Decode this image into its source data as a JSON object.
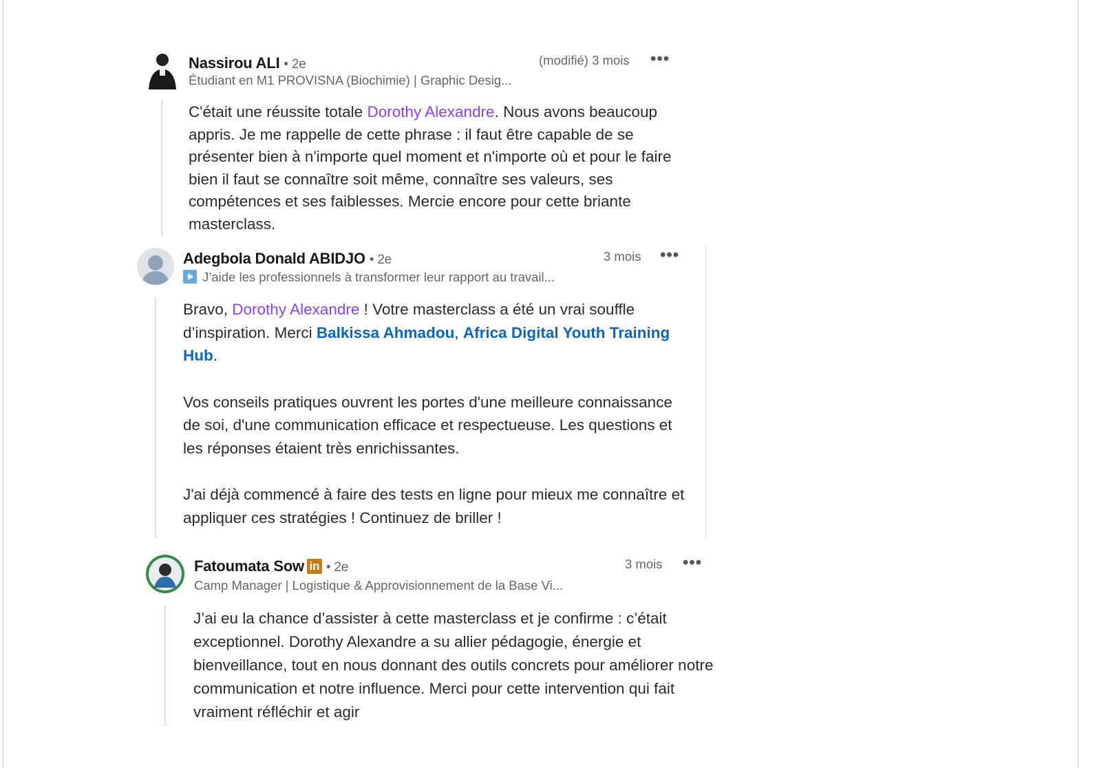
{
  "comments": [
    {
      "author": "Nassirou ALI",
      "degree": "• 2e",
      "headline": "Étudiant en M1 PROVISNA (Biochimie) | Graphic Desig...",
      "time": "(modifié) 3 mois",
      "more_icon": "ellipsis-icon",
      "text_before": "C'était une réussite totale ",
      "mention": "Dorothy Alexandre",
      "text_after": ". Nous avons beaucoup appris. Je me rappelle de cette phrase : il faut être capable de se présenter bien à n'importe quel moment et n'importe où et pour le faire bien il faut se connaître soit même, connaître ses valeurs, ses compétences et ses faiblesses. Mercie encore pour cette briante masterclass."
    },
    {
      "author": "Adegbola Donald ABIDJO",
      "degree": "• 2e",
      "headline": "J’aide les professionnels à transformer leur rapport au travail...",
      "time": "3 mois",
      "more_icon": "ellipsis-icon",
      "p1_before": "Bravo, ",
      "p1_mention": "Dorothy Alexandre",
      "p1_middle": " ! Votre masterclass a été un vrai souffle d’inspiration. Merci ",
      "p1_link1": "Balkissa Ahmadou",
      "p1_comma": ", ",
      "p1_link2": "Africa Digital Youth Training Hub",
      "p1_end": ".",
      "p2": "Vos conseils pratiques ouvrent les portes d'une meilleure connaissance de soi, d'une communication efficace et respectueuse. Les questions et les réponses étaient très enrichissantes.",
      "p3": "J'ai déjà commencé à faire des tests en ligne pour mieux me connaître et appliquer ces stratégies ! Continuez de briller !"
    },
    {
      "author": "Fatoumata Sow",
      "badge": "in",
      "degree": "• 2e",
      "headline": "Camp Manager | Logistique & Approvisionnement de la Base Vi...",
      "time": "3 mois",
      "more_icon": "ellipsis-icon",
      "text": "J’ai eu la chance d’assister à cette masterclass et je confirme : c’était exceptionnel. Dorothy Alexandre a su allier pédagogie, énergie et bienveillance, tout en nous donnant des outils concrets pour améliorer notre communication et notre influence. Merci pour cette intervention qui fait vraiment réfléchir et agir"
    }
  ],
  "colors": {
    "mention": "#8a3ffc",
    "link": "#0a66c2",
    "muted": "#666666"
  }
}
